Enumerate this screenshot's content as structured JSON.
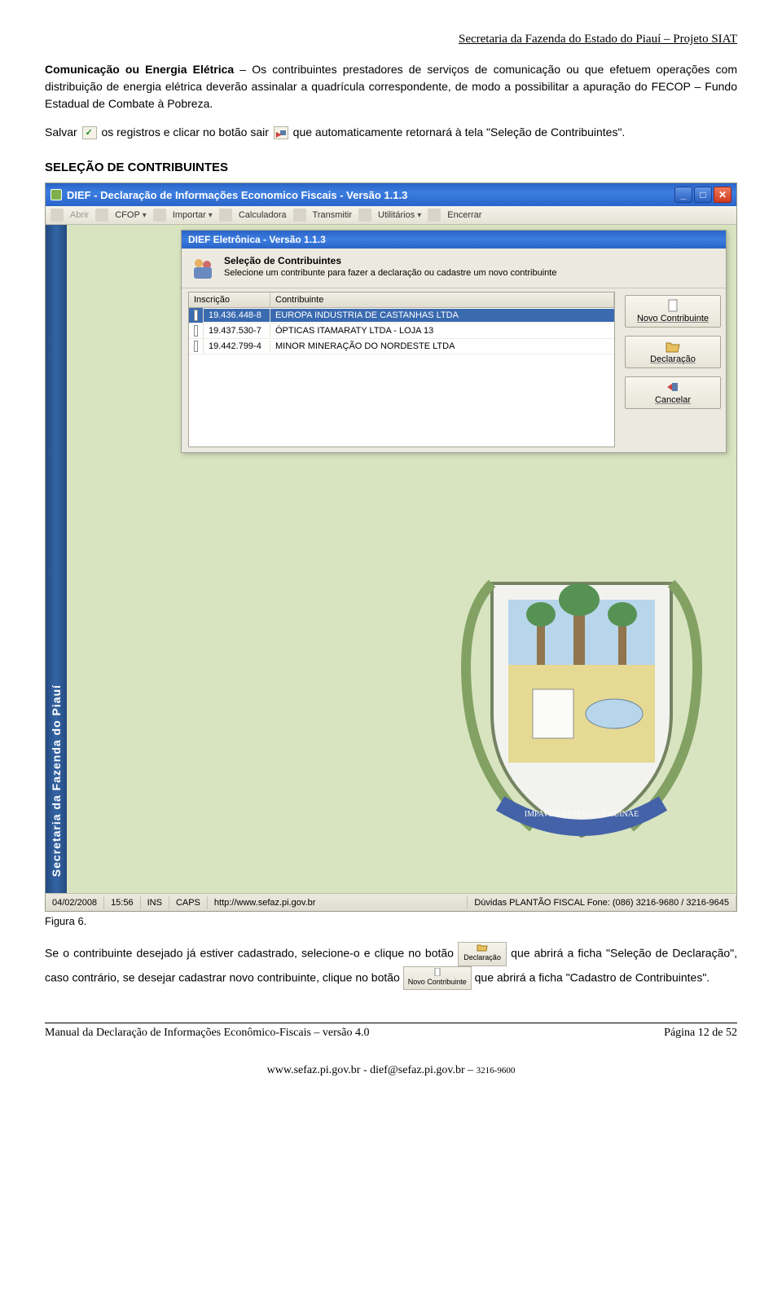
{
  "header_right": "Secretaria da Fazenda do Estado do Piauí – Projeto SIAT",
  "para1_bold": "Comunicação ou Energia Elétrica",
  "para1_text": " – Os contribuintes prestadores de serviços de comunicação ou que efetuem operações com distribuição de energia elétrica deverão assinalar a quadrícula correspondente, de modo a possibilitar a apuração do FECOP – Fundo Estadual de Combate à Pobreza.",
  "para2_a": "Salvar ",
  "para2_b": " os registros e clicar no botão sair ",
  "para2_c": " que automaticamente retornará à tela \"Seleção de Contribuintes\".",
  "section_heading": "SELEÇÃO DE CONTRIBUINTES",
  "window": {
    "title": "DIEF - Declaração de Informações Economico Fiscais - Versão 1.1.3",
    "toolbar": {
      "abrir": "Abrir",
      "cfop": "CFOP",
      "importar": "Importar",
      "calculadora": "Calculadora",
      "transmitir": "Transmitir",
      "utilitarios": "Utilitários",
      "encerrar": "Encerrar"
    },
    "rail": "Secretaria da Fazenda do Piauí",
    "inner": {
      "title": "DIEF Eletrônica - Versão 1.1.3",
      "head_bold": "Seleção de Contribuintes",
      "head_text": "Selecione um contribunte para fazer a declaração ou cadastre um novo contribuinte",
      "col1": "Inscrição",
      "col2": "Contribuinte",
      "rows": [
        {
          "inscricao": "19.436.448-8",
          "contribuinte": "EUROPA INDUSTRIA DE CASTANHAS LTDA"
        },
        {
          "inscricao": "19.437.530-7",
          "contribuinte": "ÓPTICAS ITAMARATY LTDA - LOJA 13"
        },
        {
          "inscricao": "19.442.799-4",
          "contribuinte": "MINOR MINERAÇÃO DO NORDESTE LTDA"
        }
      ],
      "btn_novo": "Novo Contribuinte",
      "btn_decl": "Declaração",
      "btn_cancel": "Cancelar"
    },
    "status": {
      "date": "04/02/2008",
      "time": "15:56",
      "ins": "INS",
      "caps": "CAPS",
      "url": "http://www.sefaz.pi.gov.br",
      "right": "Dúvidas PLANTÃO FISCAL Fone: (086) 3216-9680 / 3216-9645"
    }
  },
  "figura": "Figura 6.",
  "para3_a": "Se o contribuinte desejado já estiver cadastrado, selecione-o e clique no botão ",
  "para3_b": " que abrirá a ficha \"Seleção de Declaração\", caso contrário, se desejar cadastrar novo contribuinte, clique no botão ",
  "para3_c": " que abrirá a ficha \"Cadastro de Contribuintes\".",
  "btn_inline_decl": "Declaração",
  "btn_inline_novo": "Novo Contribuinte",
  "footer_left": "Manual da Declaração de Informações Econômico-Fiscais – versão 4.0",
  "footer_right": "Página 12 de 52",
  "footer_center_a": "www.sefaz.pi.gov.br - dief@sefaz.pi.gov.br – ",
  "footer_center_b": "3216-9600"
}
